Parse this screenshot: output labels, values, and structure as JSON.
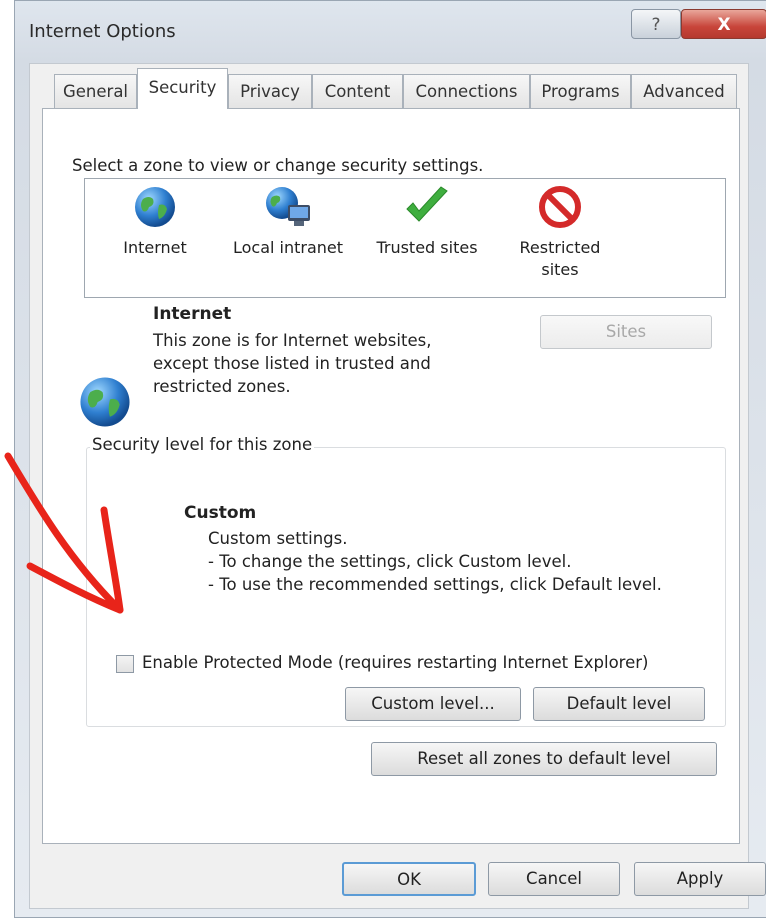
{
  "window": {
    "title": "Internet Options",
    "help_label": "?",
    "close_label": "X"
  },
  "tabs": [
    {
      "label": "General"
    },
    {
      "label": "Security",
      "active": true
    },
    {
      "label": "Privacy"
    },
    {
      "label": "Content"
    },
    {
      "label": "Connections"
    },
    {
      "label": "Programs"
    },
    {
      "label": "Advanced"
    }
  ],
  "security": {
    "zone_prompt": "Select a zone to view or change security settings.",
    "zones": [
      {
        "label": "Internet",
        "icon": "globe-icon"
      },
      {
        "label": "Local intranet",
        "icon": "intranet-icon"
      },
      {
        "label": "Trusted sites",
        "icon": "checkmark-icon"
      },
      {
        "label_line1": "Restricted",
        "label_line2": "sites",
        "icon": "restricted-icon"
      }
    ],
    "selected_zone": {
      "name": "Internet",
      "desc_line1": "This zone is for Internet websites,",
      "desc_line2": "except those listed in trusted and",
      "desc_line3": "restricted zones."
    },
    "sites_button": "Sites",
    "level_group_label": "Security level for this zone",
    "level": {
      "name": "Custom",
      "line1": "Custom settings.",
      "line2": "- To change the settings, click Custom level.",
      "line3": "- To use the recommended settings, click Default level."
    },
    "protected_mode_label": "Enable Protected Mode (requires restarting Internet Explorer)",
    "protected_mode_checked": false,
    "custom_level_button": "Custom level...",
    "default_level_button": "Default level",
    "reset_all_button": "Reset all zones to default level"
  },
  "footer": {
    "ok": "OK",
    "cancel": "Cancel",
    "apply": "Apply"
  },
  "colors": {
    "annotation_arrow": "#e8241a",
    "close_button": "#c8453a",
    "focus_border": "#5b9bd5"
  }
}
